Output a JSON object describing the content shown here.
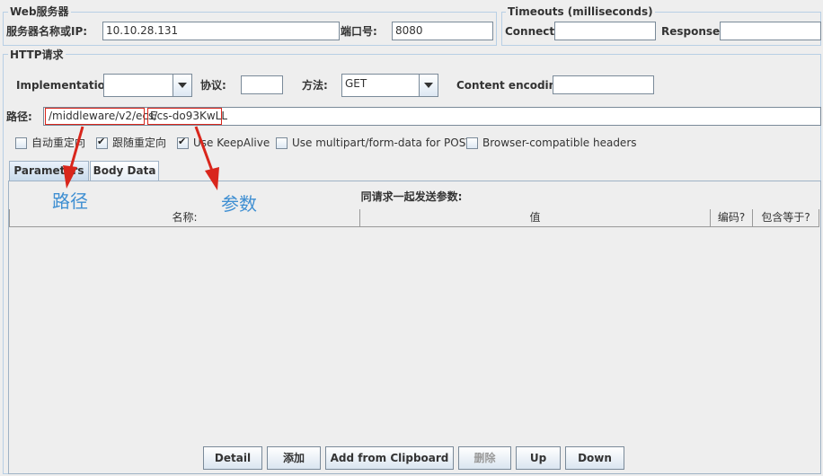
{
  "web_server": {
    "legend": "Web服务器",
    "server_label": "服务器名称或IP:",
    "server_value": "10.10.28.131",
    "port_label": "端口号:",
    "port_value": "8080"
  },
  "timeouts": {
    "legend": "Timeouts (milliseconds)",
    "connect_label": "Connect:",
    "connect_value": "",
    "response_label": "Response:",
    "response_value": ""
  },
  "http_request": {
    "legend": "HTTP请求",
    "implementation_label": "Implementation:",
    "implementation_value": "",
    "protocol_label": "协议:",
    "protocol_value": "",
    "method_label": "方法:",
    "method_value": "GET",
    "encoding_label": "Content encoding:",
    "encoding_value": "",
    "path_label": "路径:",
    "path_part1": "/middleware/v2/ecs/",
    "path_part2": "Ecs-do93KwLL"
  },
  "options": [
    {
      "label": "自动重定向",
      "checked": false
    },
    {
      "label": "跟随重定向",
      "checked": true
    },
    {
      "label": "Use KeepAlive",
      "checked": true
    },
    {
      "label": "Use multipart/form-data for POST",
      "checked": false
    },
    {
      "label": "Browser-compatible headers",
      "checked": false
    }
  ],
  "tabs": [
    {
      "label": "Parameters",
      "active": true
    },
    {
      "label": "Body Data",
      "active": false
    }
  ],
  "params": {
    "title": "同请求一起发送参数:",
    "columns": [
      "名称:",
      "值",
      "编码?",
      "包含等于?"
    ]
  },
  "buttons": {
    "detail": "Detail",
    "add": "添加",
    "add_clipboard": "Add from Clipboard",
    "delete": "删除",
    "up": "Up",
    "down": "Down"
  },
  "annotations": {
    "path": "路径",
    "param": "参数"
  },
  "colors": {
    "annotation_red": "#d9261c",
    "annotation_blue": "#3f8fd2",
    "border_blue": "#b8cfe5"
  }
}
